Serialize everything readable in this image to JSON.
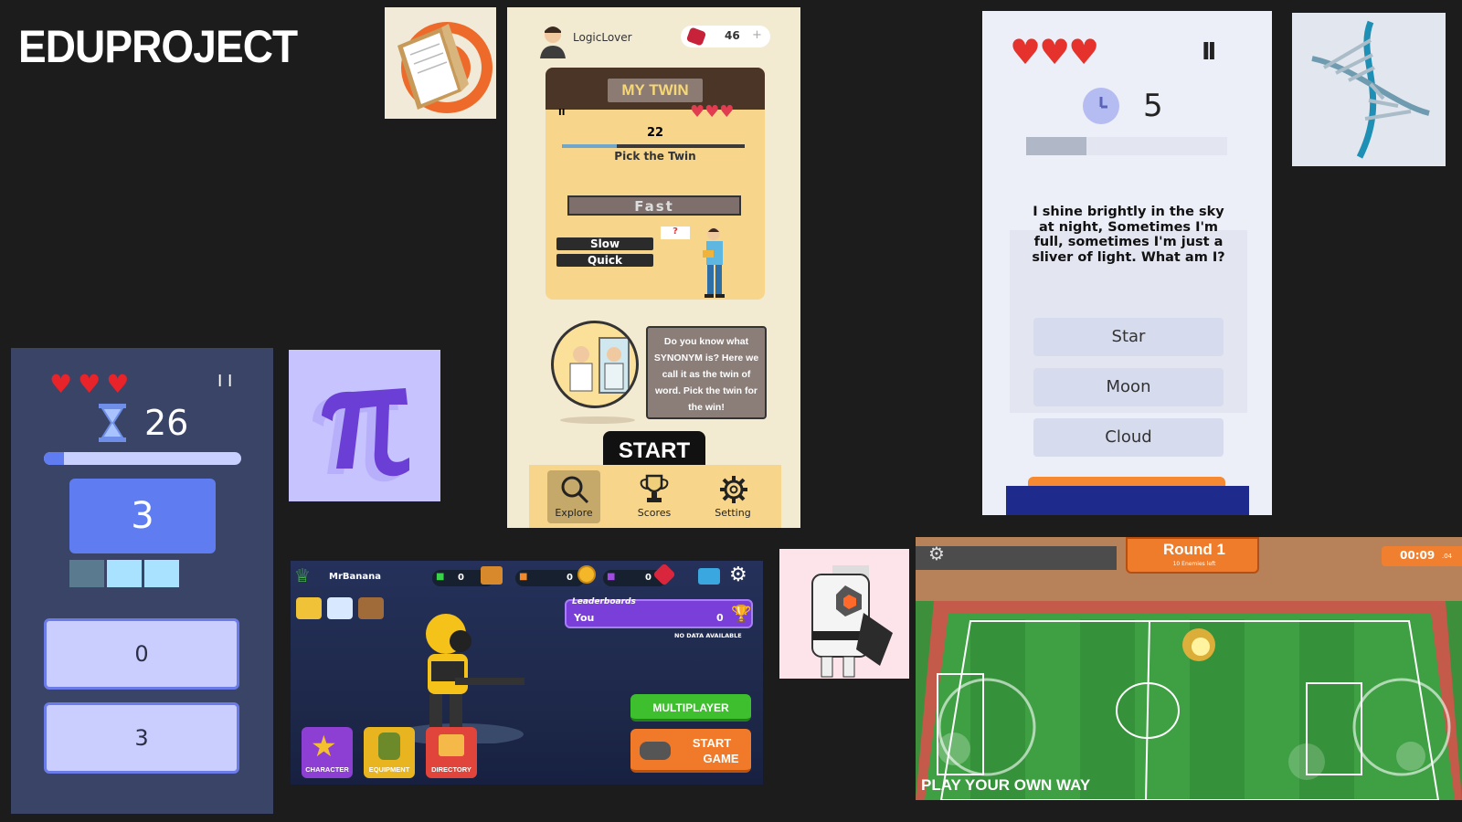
{
  "brand": {
    "title": "EDUPROJECT"
  },
  "math_game": {
    "hearts": "♥♥♥",
    "pause": "I I",
    "timer": "26",
    "progress": 0.1,
    "question": "3",
    "answers": [
      "0",
      "3"
    ]
  },
  "twin_game": {
    "username": "LogicLover",
    "gems": "46",
    "plus": "+",
    "title": "MY TWIN",
    "preview_count": "22",
    "preview_prompt": "Pick the Twin",
    "preview_word": "Fast",
    "choices": [
      "Slow",
      "Quick"
    ],
    "question_mark": "?",
    "description": "Do you know what SYNONYM is? Here we call it as the twin of word. Pick the twin for the win!",
    "start_label": "START",
    "nav": [
      {
        "label": "Explore",
        "icon": "search-icon"
      },
      {
        "label": "Scores",
        "icon": "trophy-icon"
      },
      {
        "label": "Setting",
        "icon": "gear-icon"
      }
    ]
  },
  "riddle_game": {
    "hearts": "♥♥♥",
    "pause": "II",
    "timer": "5",
    "progress": 0.3,
    "question": "I shine brightly in the sky at night, Sometimes I'm full, sometimes I'm just a sliver of light. What am I?",
    "answers": [
      "Star",
      "Moon",
      "Cloud"
    ]
  },
  "shooter_game": {
    "player": "MrBanana",
    "currency": [
      "0",
      "0",
      "0"
    ],
    "leaderboard_title": "Leaderboards",
    "leaderboard_user": "You",
    "leaderboard_score": "0",
    "leaderboard_note": "NO DATA AVAILABLE",
    "menu": [
      "CHARACTER",
      "EQUIPMENT",
      "DIRECTORY"
    ],
    "multiplayer_label": "MULTIPLAYER",
    "start_label_1": "START",
    "start_label_2": "GAME"
  },
  "soccer_game": {
    "round": "Round 1",
    "round_sub": "10 Enemies left",
    "timer": "00:09",
    "timer_small": ".04",
    "tagline": "PLAY YOUR OWN WAY"
  }
}
